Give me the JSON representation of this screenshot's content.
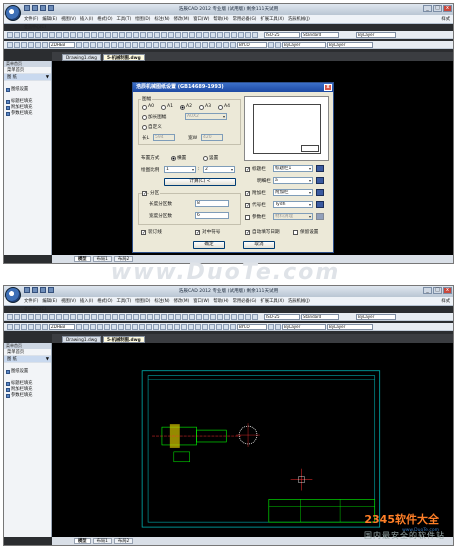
{
  "watermark": "www.DuoTe.com",
  "site_logo": {
    "text": "2345软件大全",
    "sub": "www.DuoTe.com"
  },
  "footer_slogan": "国内最安全的软件站",
  "window": {
    "title": "浩辰CAD 2012 专业版 (试用版) 剩余111天试用",
    "min": "_",
    "max": "□",
    "close": "x"
  },
  "menu": [
    "文件(F)",
    "编辑(E)",
    "视图(V)",
    "插入(I)",
    "格式(O)",
    "工具(T)",
    "绘图(D)",
    "标注(N)",
    "修改(M)",
    "窗口(W)",
    "帮助(H)",
    "常用必备(G)",
    "扩展工具(X)",
    "浩辰机械(J)"
  ],
  "menu_right": [
    "样式",
    "-",
    "□",
    "x"
  ],
  "vc_label": "会员中心(C)",
  "toolbar1": {
    "dimstyle": "ISO-25",
    "textstyle": "Standard",
    "linetype": "ByLayer"
  },
  "toolbar2": {
    "layer": "ZDHEB",
    "color": "ByLayer",
    "lineweight": "ByLayer",
    "plot": "BYCO"
  },
  "left_panel": {
    "title": "菜单首页",
    "tabs": [
      "菜单首页",
      "图 纸"
    ],
    "header_marker": "▼",
    "items": [
      "图纸设置",
      "标题栏填充",
      "附加栏填充",
      "参数栏填充"
    ]
  },
  "file_tabs": [
    "Drawing1.dwg",
    "5-机械制图.dwg"
  ],
  "layout_tabs": [
    "模型",
    "布局1",
    "布局2"
  ],
  "dialog": {
    "title": "浩辰机械图纸设置 (GB14689-1993)",
    "close": "x",
    "group_size": "图幅",
    "sizes": [
      "A0",
      "A1",
      "A2",
      "A3",
      "A4"
    ],
    "selected_size": "A2",
    "extend_label": "加长图幅",
    "extend_value": "A0X2",
    "custom_label": "自定义",
    "length_label": "长L",
    "length_value": "594",
    "width_label": "宽W",
    "width_value": "420",
    "layout_label": "布置方式",
    "horizontal": "横置",
    "vertical": "竖置",
    "scale_label": "绘图比例",
    "scale_a": "1",
    "colon": ":",
    "scale_b": "2",
    "calc_button": "计算(C) <",
    "zone_label": "分区",
    "zone_len_label": "长度分区数",
    "zone_len_value": "8",
    "zone_wid_label": "宽度分区数",
    "zone_wid_value": "6",
    "title_bar_label": "标题栏",
    "title_bar_value": "标题栏1",
    "detail_label": "明细栏",
    "detail_value": "a",
    "extra_label": "附加栏",
    "extra_value": "附加栏",
    "code_label": "代号栏",
    "code_value": "Tydh",
    "param_label": "参数栏",
    "param_value": "材料清理",
    "binding_label": "装订线",
    "center_mark_label": "对中符号",
    "auto_date_label": "自动填写日期",
    "keep_label": "保留设置",
    "ok": "确定",
    "cancel": "取消"
  },
  "colors": {
    "dialog_title_bg": "#1d4aa3",
    "canvas_bg": "#000000",
    "drawing_frame": "#00b0b0",
    "drawing_green": "#00ff00"
  }
}
